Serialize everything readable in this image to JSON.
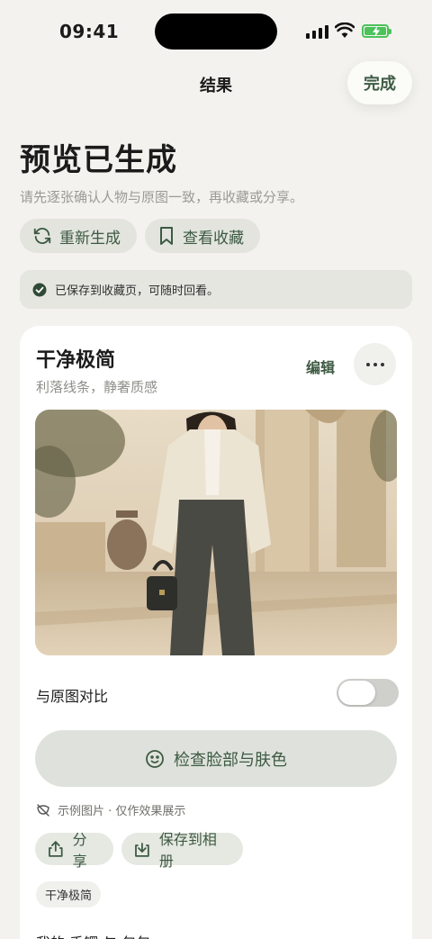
{
  "status": {
    "time": "09:41"
  },
  "nav": {
    "title": "结果",
    "done": "完成"
  },
  "header": {
    "title": "预览已生成",
    "subtitle": "请先逐张确认人物与原图一致，再收藏或分享。"
  },
  "actions": {
    "regenerate": "重新生成",
    "view_favorites": "查看收藏"
  },
  "notice": {
    "text": "已保存到收藏页，可随时回看。"
  },
  "card": {
    "title": "干净极简",
    "subtitle": "利落线条，静奢质感",
    "edit": "编辑",
    "compare_label": "与原图对比",
    "compare_enabled": false,
    "check_button": "检查脸部与肤色",
    "sample_note": "示例图片 · 仅作效果展示",
    "share": "分享",
    "save_album": "保存到相册",
    "tag": "干净极简",
    "footer_partial": "我的 手镯 与 包包"
  },
  "colors": {
    "accent": "#3d5a43",
    "background": "#f3f2ee",
    "battery": "#4cc25b"
  },
  "icons": [
    "refresh-icon",
    "bookmark-icon",
    "check-circle-icon",
    "more-icon",
    "face-icon",
    "image-off-icon",
    "share-icon",
    "download-icon"
  ]
}
